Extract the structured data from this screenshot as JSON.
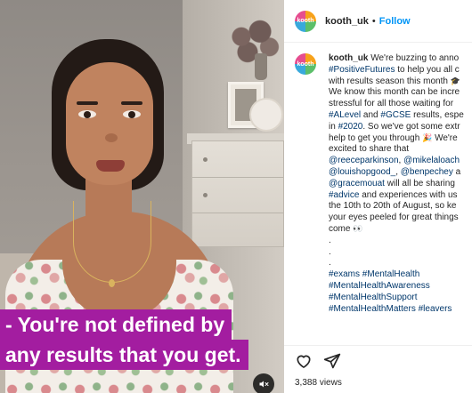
{
  "video": {
    "caption_lines": [
      "- You're not defined by",
      "any results that you get."
    ],
    "sound_button_icon": "volume-muted-icon"
  },
  "post": {
    "account": {
      "avatar_text": "kooth",
      "username": "kooth_uk",
      "separator": "•",
      "follow_label": "Follow"
    },
    "caption": {
      "username": "kooth_uk",
      "lines": [
        [
          "We're buzzing to anno"
        ],
        [
          "#PositiveFutures",
          " to help you all c"
        ],
        [
          "with results season this month ",
          "🎓"
        ],
        [
          "We know this month can be incre"
        ],
        [
          "stressful for all those waiting for"
        ],
        [
          "#ALevel",
          " and ",
          "#GCSE",
          " results, espe"
        ],
        [
          "in ",
          "#2020",
          ". So we've got some extr"
        ],
        [
          "help to get you through ",
          "🎉",
          " We're"
        ],
        [
          "excited to share that"
        ],
        [
          "@reeceparkinson",
          ", ",
          "@mikelaloach"
        ],
        [
          "@louishopgood_",
          ", ",
          "@benpechey",
          " a"
        ],
        [
          "@gracemouat",
          " will all be sharing"
        ],
        [
          "#advice",
          " and experiences with us"
        ],
        [
          "the 10th to 20th of August, so ke"
        ],
        [
          "your eyes peeled for great things"
        ],
        [
          "come ",
          "👀"
        ],
        [
          "."
        ],
        [
          "."
        ],
        [
          "."
        ],
        [
          "#exams",
          " ",
          "#MentalHealth"
        ],
        [
          "#MentalHealthAwareness"
        ],
        [
          "#MentalHealthSupport"
        ],
        [
          "#MentalHealthMatters",
          " ",
          "#leavers"
        ]
      ]
    },
    "actions": {
      "like_icon": "heart-icon",
      "share_icon": "paper-plane-icon"
    },
    "views_count": "3,388",
    "views_label": "views"
  },
  "colors": {
    "caption_bg": "#a31da0",
    "link_blue": "#00376b",
    "follow_blue": "#0095f6"
  }
}
